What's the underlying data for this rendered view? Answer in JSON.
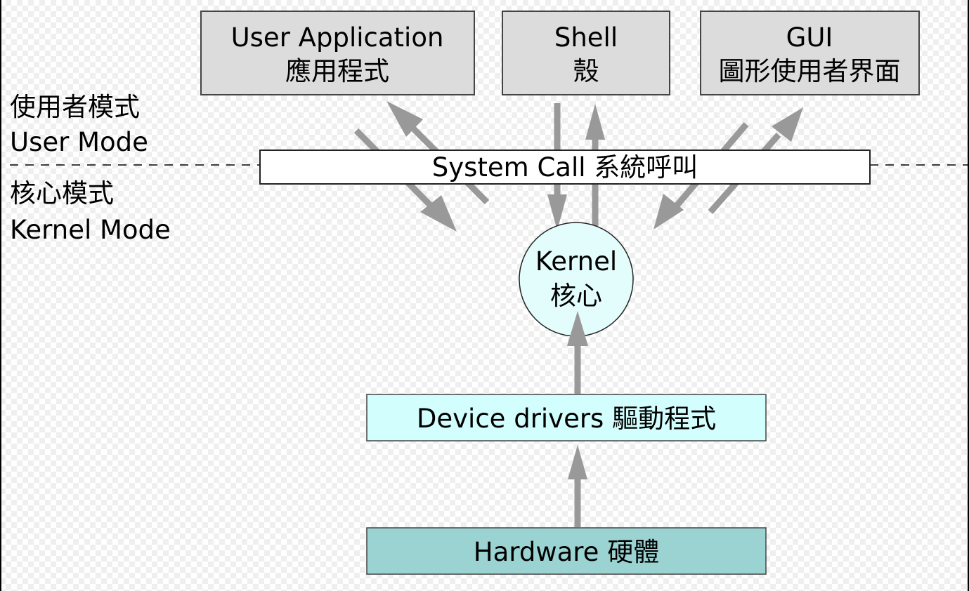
{
  "modes": {
    "user": {
      "zh": "使用者模式",
      "en": "User Mode"
    },
    "kernel": {
      "zh": "核心模式",
      "en": "Kernel Mode"
    }
  },
  "boxes": {
    "user_application": {
      "en": "User Application",
      "zh": "應用程式"
    },
    "shell": {
      "en": "Shell",
      "zh": "殼"
    },
    "gui": {
      "en": "GUI",
      "zh": "圖形使用者界面"
    },
    "system_call": {
      "label": "System Call 系統呼叫"
    },
    "kernel": {
      "en": "Kernel",
      "zh": "核心"
    },
    "device_drivers": {
      "label": "Device drivers 驅動程式"
    },
    "hardware": {
      "label": "Hardware 硬體"
    }
  },
  "colors": {
    "top_box_fill": "#dcdcdc",
    "system_call_fill": "#ffffff",
    "kernel_fill": "#e3fdfd",
    "drivers_fill": "#d2fefe",
    "hardware_fill": "#9bd3d3",
    "arrow": "#999999"
  }
}
